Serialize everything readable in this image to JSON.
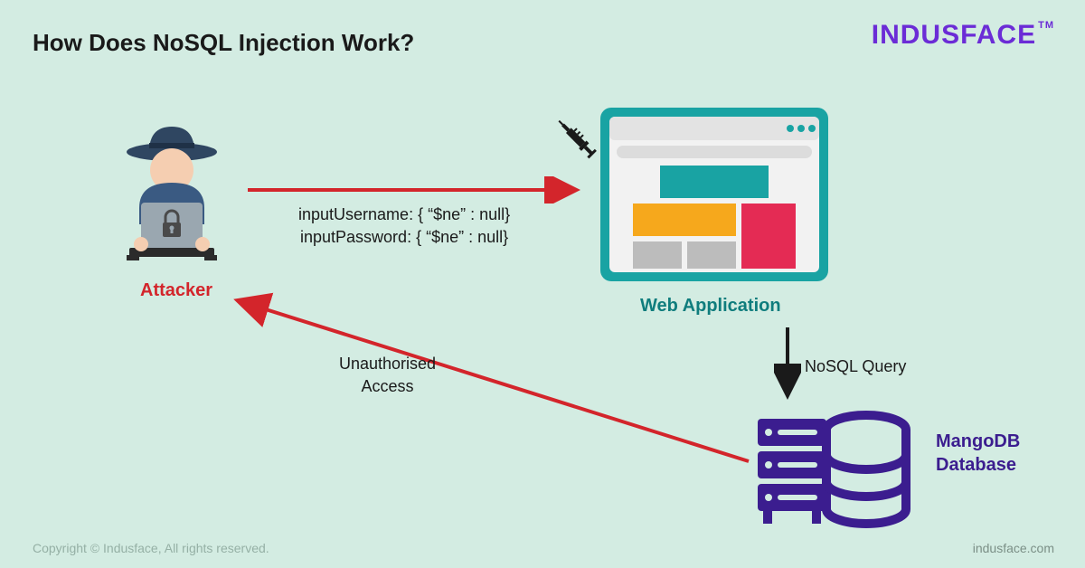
{
  "title": "How Does NoSQL Injection Work?",
  "brand": "INDUSFACE",
  "brand_tm": "TM",
  "copyright": "Copyright © Indusface, All rights reserved.",
  "site": "indusface.com",
  "nodes": {
    "attacker": "Attacker",
    "webapp": "Web Application",
    "database_line1": "MangoDB",
    "database_line2": "Database"
  },
  "payload": {
    "line1": "inputUsername: { “$ne” : null}",
    "line2": "inputPassword: { “$ne” : null}"
  },
  "edges": {
    "query": "NoSQL Query",
    "unauth_line1": "Unauthorised",
    "unauth_line2": "Access"
  }
}
